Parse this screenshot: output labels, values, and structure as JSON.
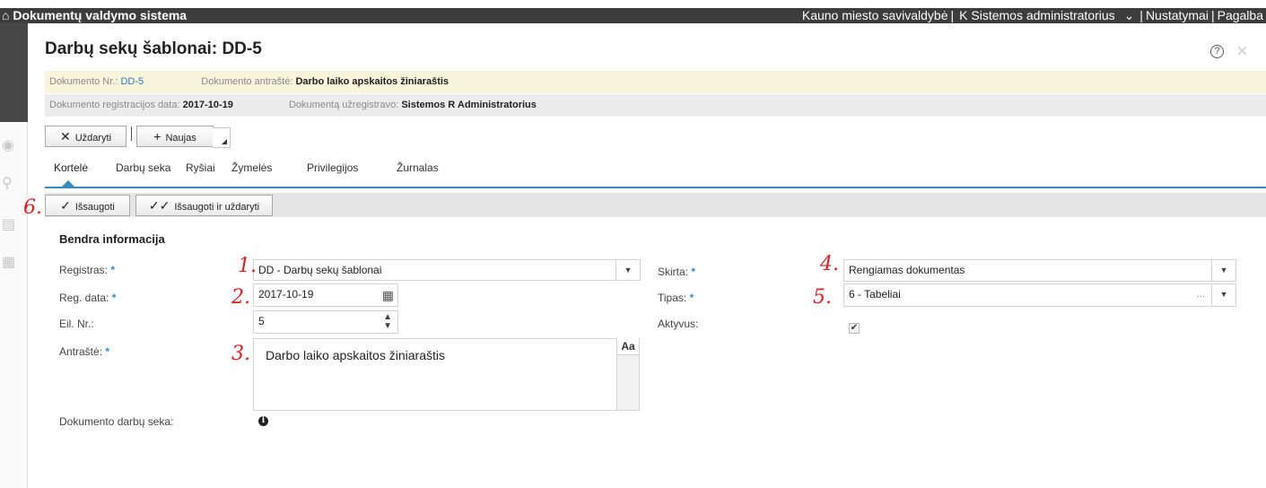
{
  "topbar": {
    "app_title": "Dokumentų valdymo sistema",
    "org": "Kauno miesto savivaldybė",
    "user": "K Sistemos administratorius",
    "settings": "Nustatymai",
    "help": "Pagalba"
  },
  "page": {
    "title": "Darbų sekų šablonai: DD-5",
    "help_glyph": "?",
    "close_glyph": "×"
  },
  "info": {
    "doc_no_label": "Dokumento Nr.:",
    "doc_no": "DD-5",
    "heading_label": "Dokumento antraštė:",
    "heading": "Darbo laiko apskaitos žiniaraštis",
    "reg_date_label": "Dokumento registracijos data:",
    "reg_date": "2017-10-19",
    "registered_by_label": "Dokumentą užregistravo:",
    "registered_by": "Sistemos R Administratorius"
  },
  "toolbar": {
    "close_label": "Uždaryti",
    "new_label": "Naujas"
  },
  "tabs": [
    {
      "label": "Kortelė"
    },
    {
      "label": "Darbų seka"
    },
    {
      "label": "Ryšiai"
    },
    {
      "label": "Žymelės"
    },
    {
      "label": "Privilegijos"
    },
    {
      "label": "Žurnalas"
    }
  ],
  "actions": {
    "save_label": "Išsaugoti",
    "save_close_label": "Išsaugoti ir uždaryti"
  },
  "form": {
    "section_title": "Bendra informacija",
    "registras_label": "Registras:",
    "registras_value": "DD - Darbų sekų šablonai",
    "reg_date_label": "Reg. data:",
    "reg_date_value": "2017-10-19",
    "eil_nr_label": "Eil. Nr.:",
    "eil_nr_value": "5",
    "antraste_label": "Antraštė:",
    "antraste_value": "Darbo laiko apskaitos žiniaraštis",
    "aa_label": "Aa",
    "darbu_seka_label": "Dokumento darbų seka:",
    "skirta_label": "Skirta:",
    "skirta_value": "Rengiamas dokumentas",
    "tipas_label": "Tipas:",
    "tipas_value": "6 - Tabeliai",
    "tipas_dots": "...",
    "aktyvus_label": "Aktyvus:",
    "aktyvus_checked": true,
    "required_mark": "*"
  },
  "annotations": [
    "1.",
    "2.",
    "3.",
    "4.",
    "5.",
    "6."
  ],
  "colors": {
    "accent": "#3a8bbd",
    "topbar": "#3d3d3d",
    "infobar_yellow": "#f7f4dc",
    "infobar_gray": "#ececec",
    "annotation_red": "#e02020"
  },
  "icons": {
    "topbar_logo": "home-icon",
    "close": "close-x-icon",
    "new": "plus-icon",
    "save": "check-icon",
    "save_close": "double-check-icon",
    "calendar": "calendar-icon",
    "spinner": "spinner-icon",
    "dropdown": "chevron-down-icon",
    "info": "info-icon"
  }
}
